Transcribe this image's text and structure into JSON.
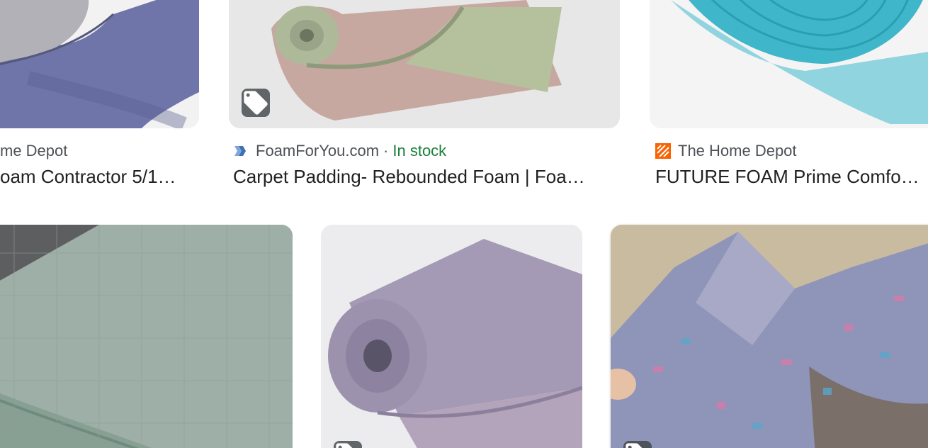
{
  "results_row1": [
    {
      "source": "me Depot",
      "title": "oam Contractor 5/1…",
      "favicon": "none",
      "thumb_colors": [
        "#9aa0c2",
        "#b8b6be"
      ]
    },
    {
      "source": "FoamForYou.com",
      "separator": "·",
      "stock": "In stock",
      "title": "Carpet Padding- Rebounded Foam | Foa…",
      "favicon": "foamforyou-favicon",
      "badge": "price-tag-icon",
      "thumb_colors": [
        "#dadada",
        "#c9b7a8",
        "#b5bc9f"
      ]
    },
    {
      "source": "The Home Depot",
      "title": "FUTURE FOAM Prime Comfo…",
      "favicon": "home-depot-favicon",
      "thumb_colors": [
        "#f3f3f3",
        "#3fb6c9"
      ]
    }
  ],
  "results_row2": [
    {
      "thumb_colors": [
        "#5c5c5c",
        "#9fb0a8"
      ]
    },
    {
      "thumb_colors": [
        "#e9e9ec",
        "#a59ab5"
      ],
      "badge": "price-tag-icon"
    },
    {
      "thumb_colors": [
        "#c8b89c",
        "#8e95b8"
      ],
      "badge": "price-tag-icon"
    }
  ],
  "colors": {
    "source_text": "#4d5156",
    "title_text": "#202124",
    "in_stock": "#188038",
    "badge_bg": "#3c4043"
  }
}
